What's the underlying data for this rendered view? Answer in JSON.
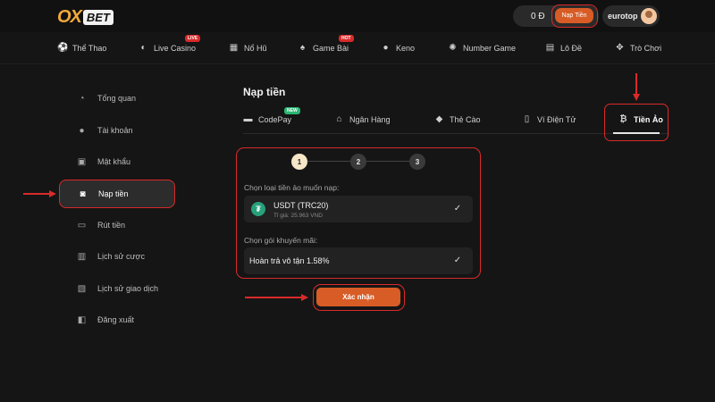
{
  "header": {
    "logo_ox": "OX",
    "logo_bet": "BET",
    "balance": "0 Đ",
    "deposit_button": "Nạp Tiền",
    "username": "eurotop"
  },
  "nav": {
    "items": [
      {
        "label": "Thể Thao",
        "icon": "soccer-ball-icon"
      },
      {
        "label": "Live Casino",
        "icon": "mask-icon",
        "badge": "LIVE"
      },
      {
        "label": "Nổ Hũ",
        "icon": "slot-777-icon"
      },
      {
        "label": "Game Bài",
        "icon": "spade-icon",
        "badge": "HOT"
      },
      {
        "label": "Keno",
        "icon": "keno-ball-icon"
      },
      {
        "label": "Number Game",
        "icon": "number-wheel-icon"
      },
      {
        "label": "Lô Đề",
        "icon": "lottery-ticket-icon"
      },
      {
        "label": "Trò Chơi",
        "icon": "gamepad-icon"
      }
    ]
  },
  "sidebar": {
    "items": [
      {
        "label": "Tổng quan",
        "icon": "overview-icon"
      },
      {
        "label": "Tài khoản",
        "icon": "user-icon"
      },
      {
        "label": "Mật khẩu",
        "icon": "lock-icon"
      },
      {
        "label": "Nạp tiền",
        "icon": "deposit-icon",
        "active": true
      },
      {
        "label": "Rút tiền",
        "icon": "withdraw-icon"
      },
      {
        "label": "Lịch sử cược",
        "icon": "bet-history-icon"
      },
      {
        "label": "Lịch sử giao dịch",
        "icon": "transaction-history-icon"
      },
      {
        "label": "Đăng xuất",
        "icon": "logout-icon"
      }
    ]
  },
  "main": {
    "title": "Nạp tiền",
    "tabs": [
      {
        "label": "CodePay",
        "icon": "codepay-icon",
        "badge": "NEW"
      },
      {
        "label": "Ngân Hàng",
        "icon": "bank-icon"
      },
      {
        "label": "Thẻ Cào",
        "icon": "scratch-card-icon"
      },
      {
        "label": "Ví Điện Tử",
        "icon": "e-wallet-icon"
      },
      {
        "label": "Tiền Ảo",
        "icon": "bitcoin-icon",
        "active": true
      }
    ],
    "steps": [
      "1",
      "2",
      "3"
    ],
    "current_step": 1,
    "coin_label": "Chọn loại tiền ảo muốn nạp:",
    "coin_name": "USDT (TRC20)",
    "coin_rate": "Tỉ giá: 25.963 VND",
    "promo_label": "Chọn gói khuyến mãi:",
    "promo_name": "Hoàn trả vô tận 1.58%",
    "confirm_button": "Xác nhận"
  },
  "colors": {
    "accent": "#d85c26",
    "highlight": "#d92a2a",
    "background": "#151515",
    "tether": "#26a17b"
  }
}
